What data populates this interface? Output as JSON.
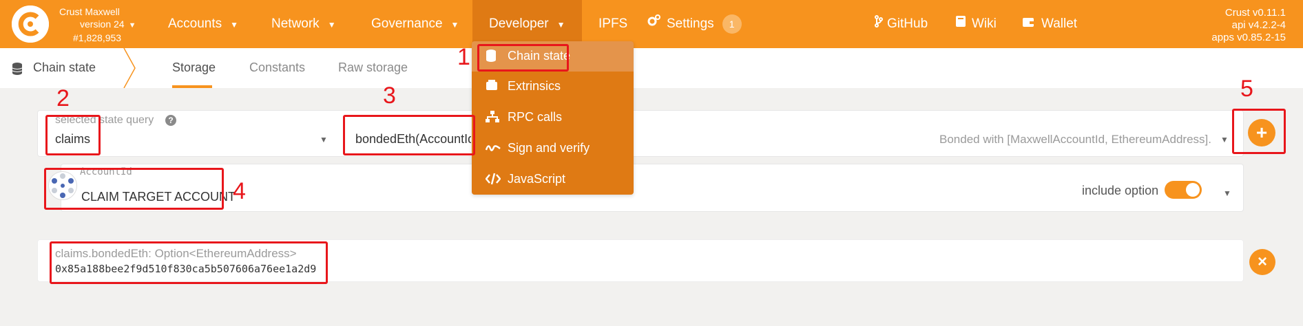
{
  "topbar": {
    "chain_name": "Crust Maxwell",
    "chain_version": "version 24",
    "block_number": "#1,828,953",
    "nav": {
      "accounts": "Accounts",
      "network": "Network",
      "governance": "Governance",
      "developer": "Developer",
      "ipfs": "IPFS",
      "settings": "Settings",
      "settings_badge": "1",
      "github": "GitHub",
      "wiki": "Wiki",
      "wallet": "Wallet"
    },
    "versions": {
      "crust": "Crust v0.11.1",
      "api": "api v4.2.2-4",
      "apps": "apps v0.85.2-15"
    },
    "accent_color": "#f7931e"
  },
  "developer_menu": {
    "items": [
      {
        "label": "Chain state",
        "icon": "database-icon"
      },
      {
        "label": "Extrinsics",
        "icon": "envelope-icon"
      },
      {
        "label": "RPC calls",
        "icon": "network-icon"
      },
      {
        "label": "Sign and verify",
        "icon": "signature-icon"
      },
      {
        "label": "JavaScript",
        "icon": "code-icon"
      }
    ]
  },
  "subnav": {
    "section_title": "Chain state",
    "tabs": [
      "Storage",
      "Constants",
      "Raw storage"
    ],
    "active_tab": "Storage"
  },
  "query": {
    "label": "selected state query",
    "module": "claims",
    "method": "bondedEth(AccountId)",
    "method_description": "Bonded with [MaxwellAccountId, EthereumAddress].",
    "param_label": "AccountId",
    "param_value": "CLAIM TARGET ACCOUNT",
    "include_option_label": "include option",
    "include_option_enabled": true
  },
  "result": {
    "label": "claims.bondedEth: Option<EthereumAddress>",
    "value": "0x85a188bee2f9d510f830ca5b507606a76ee1a2d9"
  },
  "annotations": [
    "1",
    "2",
    "3",
    "4",
    "5"
  ],
  "annotation_color": "#e8161b"
}
